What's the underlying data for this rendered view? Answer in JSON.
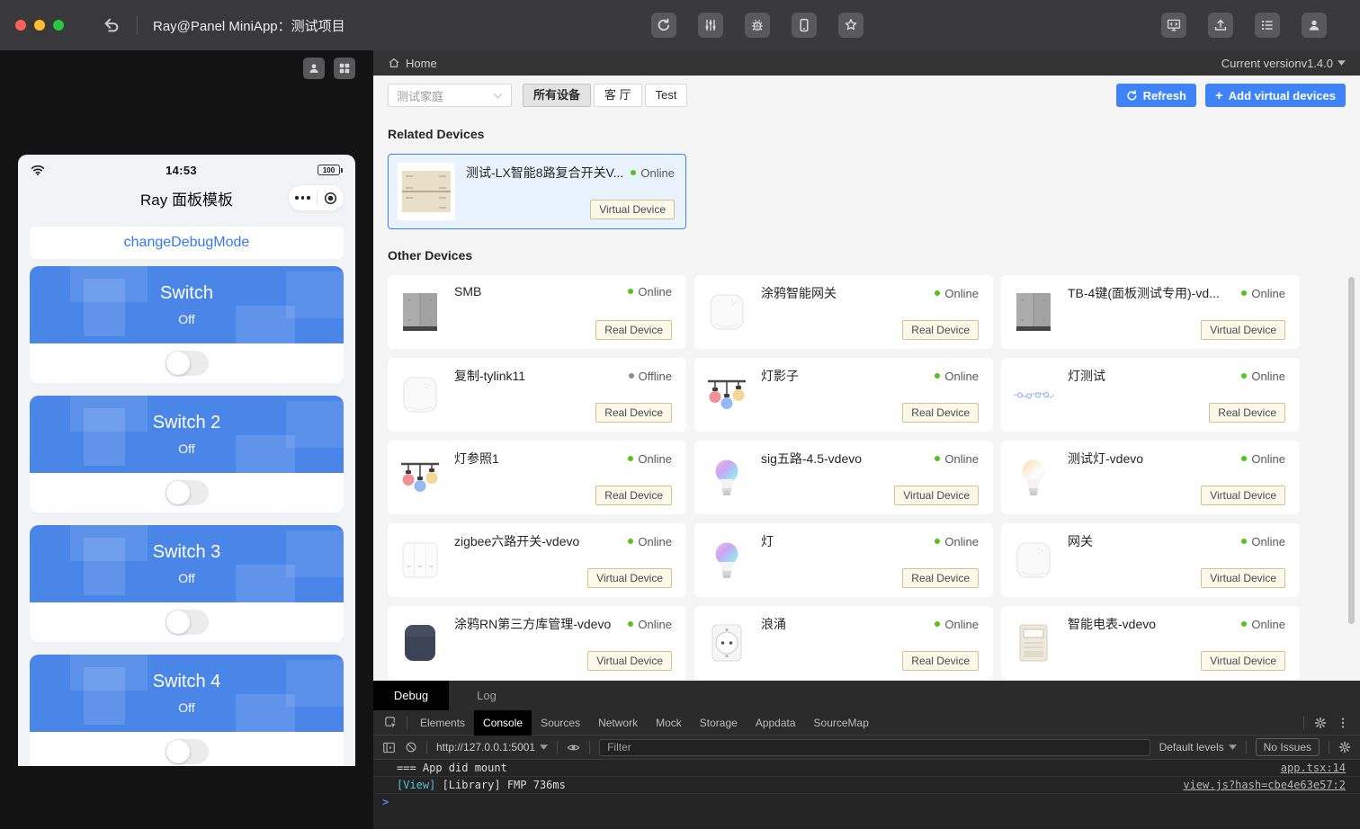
{
  "titlebar": {
    "title": "Ray@Panel MiniApp：测试项目",
    "center_tools": [
      "refresh",
      "tune",
      "bug",
      "device",
      "star"
    ],
    "right_tools": [
      "editor",
      "upload",
      "list",
      "account"
    ]
  },
  "simulator": {
    "toolbar_icons": [
      "person",
      "grid"
    ],
    "status_time": "14:53",
    "battery_level": "100",
    "nav_title": "Ray 面板模板",
    "debug_button": "changeDebugMode",
    "switches": [
      {
        "title": "Switch",
        "state": "Off"
      },
      {
        "title": "Switch 2",
        "state": "Off"
      },
      {
        "title": "Switch 3",
        "state": "Off"
      },
      {
        "title": "Switch 4",
        "state": "Off"
      }
    ]
  },
  "panel": {
    "breadcrumb": "Home",
    "version_label": "Current version",
    "version_value": "v1.4.0",
    "family_select": "测试家庭",
    "room_tabs": [
      {
        "label": "所有设备",
        "active": true
      },
      {
        "label": "客 厅",
        "active": false
      },
      {
        "label": "Test",
        "active": false
      }
    ],
    "refresh_button": "Refresh",
    "add_plus": "+",
    "add_button": "Add virtual devices",
    "related_title": "Related Devices",
    "other_title": "Other Devices",
    "related_devices": [
      {
        "name": "测试-LX智能8路复合开关V...",
        "status": "Online",
        "tag": "Virtual Device",
        "image": "panel-beige"
      }
    ],
    "other_devices": [
      {
        "name": "SMB",
        "status": "Online",
        "tag": "Real Device",
        "image": "switch-gray"
      },
      {
        "name": "涂鸦智能网关",
        "status": "Online",
        "tag": "Real Device",
        "image": "gateway-white"
      },
      {
        "name": "TB-4键(面板测试专用)-vd...",
        "status": "Online",
        "tag": "Virtual Device",
        "image": "switch-gray"
      },
      {
        "name": "复制-tylink11",
        "status": "Offline",
        "tag": "Real Device",
        "image": "gateway-white"
      },
      {
        "name": "灯影子",
        "status": "Online",
        "tag": "Real Device",
        "image": "string-lights"
      },
      {
        "name": "灯测试",
        "status": "Online",
        "tag": "Real Device",
        "image": "light-strip"
      },
      {
        "name": "灯参照1",
        "status": "Online",
        "tag": "Real Device",
        "image": "string-lights"
      },
      {
        "name": "sig五路-4.5-vdevo",
        "status": "Online",
        "tag": "Virtual Device",
        "image": "bulb-rgb"
      },
      {
        "name": "测试灯-vdevo",
        "status": "Online",
        "tag": "Virtual Device",
        "image": "bulb-warm"
      },
      {
        "name": "zigbee六路开关-vdevo",
        "status": "Online",
        "tag": "Virtual Device",
        "image": "switch-white"
      },
      {
        "name": "灯",
        "status": "Online",
        "tag": "Real Device",
        "image": "bulb-rgb"
      },
      {
        "name": "网关",
        "status": "Online",
        "tag": "Virtual Device",
        "image": "gateway-white"
      },
      {
        "name": "涂鸦RN第三方库管理-vdevo",
        "status": "Online",
        "tag": "Virtual Device",
        "image": "gateway-dark"
      },
      {
        "name": "浪涌",
        "status": "Online",
        "tag": "Real Device",
        "image": "socket"
      },
      {
        "name": "智能电表-vdevo",
        "status": "Online",
        "tag": "Virtual Device",
        "image": "meter"
      }
    ],
    "colors": {
      "accent": "#3e83f8",
      "switch_blue": "#4a86e8",
      "link_blue": "#3478f6",
      "online_dot": "#52c41a",
      "offline_dot": "#8c8c8c",
      "tag_border": "#d8bf8e"
    }
  },
  "debugger": {
    "panel_tabs": [
      {
        "label": "Debug",
        "active": true
      },
      {
        "label": "Log",
        "active": false
      }
    ],
    "devtools_tabs": [
      "Elements",
      "Console",
      "Sources",
      "Network",
      "Mock",
      "Storage",
      "Appdata",
      "SourceMap"
    ],
    "devtools_active_tab": "Console",
    "context_url": "http://127.0.0.1:5001",
    "filter_placeholder": "Filter",
    "levels_label": "Default levels",
    "issues_label": "No Issues",
    "console_rows": [
      {
        "segments": [
          {
            "text": "=== App did mount"
          }
        ],
        "source": "app.tsx:14"
      },
      {
        "segments": [
          {
            "text": "[View]",
            "color": "#53c0d8"
          },
          {
            "text": " [Library] FMP 736ms"
          }
        ],
        "source": "view.js?hash=cbe4e63e57:2"
      }
    ],
    "prompt": ">"
  }
}
